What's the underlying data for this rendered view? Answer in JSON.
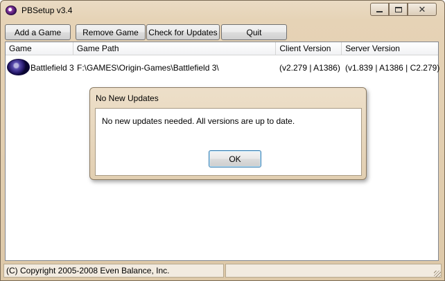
{
  "window": {
    "title": "PBSetup v3.4",
    "icon": "punkbuster-icon"
  },
  "toolbar": {
    "add_label": "Add a Game",
    "remove_label": "Remove Game",
    "check_label": "Check for Updates",
    "quit_label": "Quit"
  },
  "table": {
    "columns": [
      "Game",
      "Game Path",
      "Client Version",
      "Server Version"
    ],
    "rows": [
      {
        "icon": "battlefield-icon",
        "game": "Battlefield 3",
        "path": "F:\\GAMES\\Origin-Games\\Battlefield 3\\",
        "client": "(v2.279 | A1386)",
        "server": "(v1.839 | A1386 | C2.279)"
      }
    ]
  },
  "dialog": {
    "title": "No New Updates",
    "message": "No new updates needed.  All versions are up to date.",
    "ok_label": "OK"
  },
  "status": {
    "text": "(C) Copyright 2005-2008 Even Balance, Inc."
  }
}
